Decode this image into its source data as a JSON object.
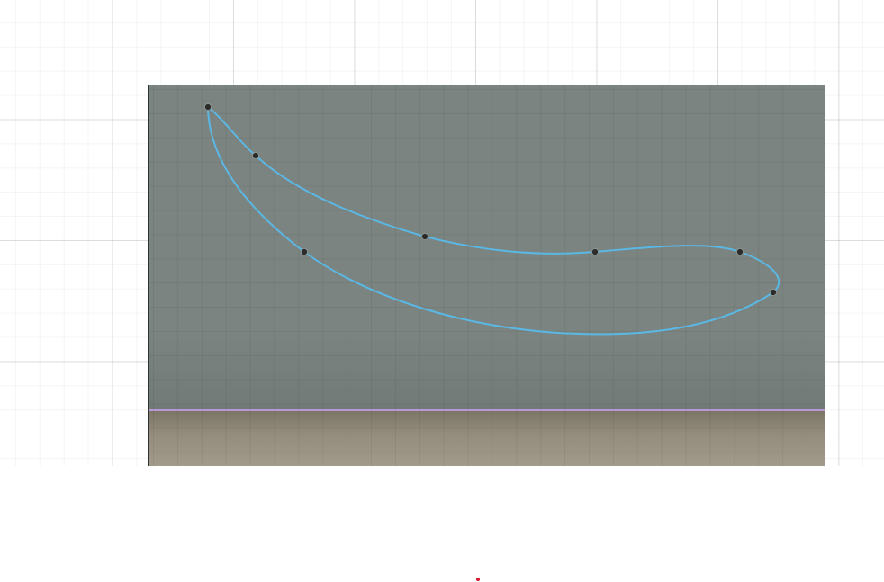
{
  "colors": {
    "background": "#ffffff",
    "sky": "#7b8480",
    "ground": "#9a9383",
    "horizon": "#b79ad6",
    "curve": "#5bb7e3",
    "handle_fill": "#2b2b2b",
    "origin_marker": "#e0142c"
  },
  "curve": {
    "type": "closed-bezier-spline",
    "anchor_count": 7,
    "closed": true
  }
}
